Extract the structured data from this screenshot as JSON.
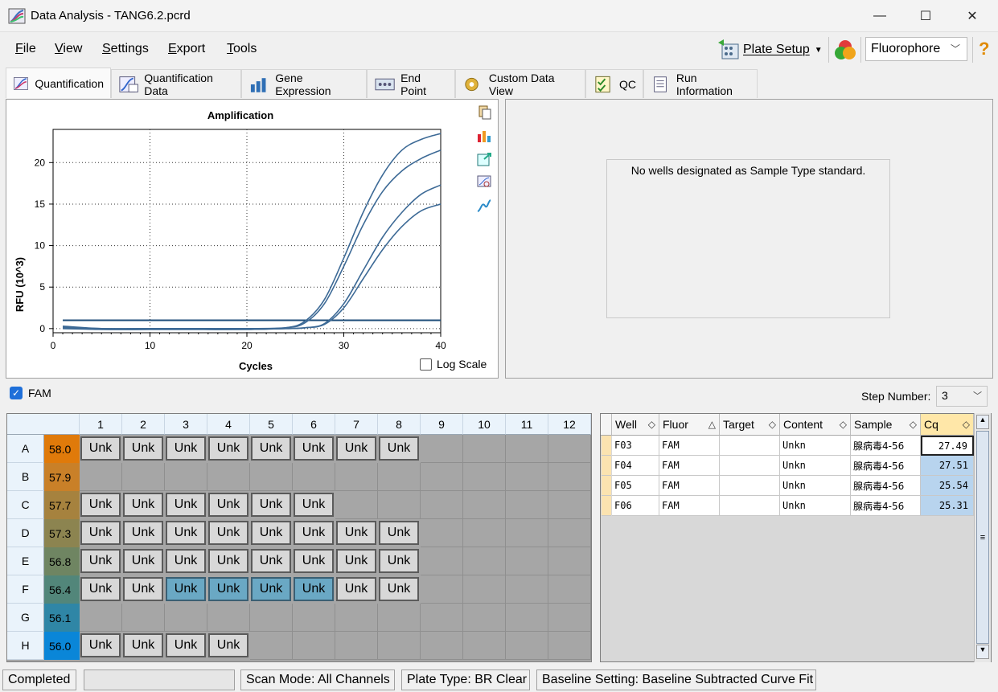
{
  "window": {
    "title": "Data Analysis - TANG6.2.pcrd",
    "minimize": "—",
    "maximize": "☐",
    "close": "✕"
  },
  "menu": {
    "items": [
      {
        "accel": "F",
        "rest": "ile"
      },
      {
        "accel": "V",
        "rest": "iew"
      },
      {
        "accel": "S",
        "rest": "ettings"
      },
      {
        "accel": "E",
        "rest": "xport"
      },
      {
        "accel": "T",
        "rest": "ools"
      }
    ],
    "plate_setup": "Plate Setup",
    "fluorophore_select": "Fluorophore",
    "help": "?"
  },
  "tabs": [
    {
      "label": "Quantification",
      "active": true
    },
    {
      "label": "Quantification Data"
    },
    {
      "label": "Gene Expression"
    },
    {
      "label": "End Point"
    },
    {
      "label": "Custom Data View"
    },
    {
      "label": "QC"
    },
    {
      "label": "Run Information"
    }
  ],
  "chart_data": {
    "type": "line",
    "title": "Amplification",
    "xlabel": "Cycles",
    "ylabel": "RFU (10^3)",
    "xlim": [
      0,
      40
    ],
    "ylim": [
      -0.5,
      24
    ],
    "xticks": [
      0,
      10,
      20,
      30,
      40
    ],
    "yticks": [
      0,
      5,
      10,
      15,
      20
    ],
    "grid": "dotted",
    "threshold": 1.0,
    "series": [
      {
        "x": [
          1,
          5,
          10,
          15,
          20,
          24,
          26,
          28,
          30,
          32,
          34,
          36,
          38,
          40
        ],
        "values": [
          0.3,
          0.0,
          0.0,
          0.0,
          0.0,
          0.1,
          0.9,
          3.5,
          8.5,
          14.0,
          18.5,
          21.5,
          22.8,
          23.5
        ]
      },
      {
        "x": [
          1,
          5,
          10,
          15,
          20,
          24,
          26,
          28,
          30,
          32,
          34,
          36,
          38,
          40
        ],
        "values": [
          0.2,
          0.0,
          0.0,
          0.0,
          0.0,
          0.1,
          0.7,
          3.0,
          7.5,
          12.5,
          16.5,
          19.0,
          20.5,
          21.5
        ]
      },
      {
        "x": [
          1,
          5,
          10,
          15,
          20,
          24,
          26,
          28,
          30,
          32,
          34,
          36,
          38,
          40
        ],
        "values": [
          0.1,
          -0.1,
          -0.1,
          -0.1,
          -0.1,
          0.0,
          0.1,
          0.6,
          3.0,
          7.0,
          11.0,
          14.0,
          16.2,
          17.3
        ]
      },
      {
        "x": [
          1,
          5,
          10,
          15,
          20,
          24,
          26,
          28,
          30,
          32,
          34,
          36,
          38,
          40
        ],
        "values": [
          0.0,
          -0.1,
          -0.1,
          -0.1,
          -0.1,
          0.0,
          0.1,
          0.5,
          2.5,
          6.0,
          9.5,
          12.3,
          14.2,
          15.0
        ]
      }
    ]
  },
  "log_scale_label": "Log Scale",
  "standards_message": "No wells designated as Sample Type standard.",
  "fam": {
    "label": "FAM",
    "checked": true
  },
  "step": {
    "label": "Step Number:",
    "value": "3"
  },
  "plate": {
    "columns": [
      "1",
      "2",
      "3",
      "4",
      "5",
      "6",
      "7",
      "8",
      "9",
      "10",
      "11",
      "12"
    ],
    "rows": [
      {
        "label": "A",
        "temp": "58.0",
        "temp_color": "#e07a0a",
        "wells": [
          "Unk",
          "Unk",
          "Unk",
          "Unk",
          "Unk",
          "Unk",
          "Unk",
          "Unk",
          "",
          "",
          "",
          ""
        ],
        "selected": []
      },
      {
        "label": "B",
        "temp": "57.9",
        "temp_color": "#c98028",
        "wells": [
          "",
          "",
          "",
          "",
          "",
          "",
          "",
          "",
          "",
          "",
          "",
          ""
        ],
        "selected": []
      },
      {
        "label": "C",
        "temp": "57.7",
        "temp_color": "#a6823e",
        "wells": [
          "Unk",
          "Unk",
          "Unk",
          "Unk",
          "Unk",
          "Unk",
          "",
          "",
          "",
          "",
          "",
          ""
        ],
        "selected": []
      },
      {
        "label": "D",
        "temp": "57.3",
        "temp_color": "#8c8450",
        "wells": [
          "Unk",
          "Unk",
          "Unk",
          "Unk",
          "Unk",
          "Unk",
          "Unk",
          "Unk",
          "",
          "",
          "",
          ""
        ],
        "selected": []
      },
      {
        "label": "E",
        "temp": "56.8",
        "temp_color": "#6f8562",
        "wells": [
          "Unk",
          "Unk",
          "Unk",
          "Unk",
          "Unk",
          "Unk",
          "Unk",
          "Unk",
          "",
          "",
          "",
          ""
        ],
        "selected": []
      },
      {
        "label": "F",
        "temp": "56.4",
        "temp_color": "#52867a",
        "wells": [
          "Unk",
          "Unk",
          "Unk",
          "Unk",
          "Unk",
          "Unk",
          "Unk",
          "Unk",
          "",
          "",
          "",
          ""
        ],
        "selected": [
          2,
          3,
          4,
          5
        ]
      },
      {
        "label": "G",
        "temp": "56.1",
        "temp_color": "#2f86a6",
        "wells": [
          "",
          "",
          "",
          "",
          "",
          "",
          "",
          "",
          "",
          "",
          "",
          ""
        ],
        "selected": []
      },
      {
        "label": "H",
        "temp": "56.0",
        "temp_color": "#0a86d8",
        "wells": [
          "Unk",
          "Unk",
          "Unk",
          "Unk",
          "",
          "",
          "",
          "",
          "",
          "",
          "",
          ""
        ],
        "selected": []
      }
    ]
  },
  "table": {
    "headers": [
      {
        "label": "Well",
        "sort": "◇"
      },
      {
        "label": "Fluor",
        "sort": "△"
      },
      {
        "label": "Target",
        "sort": "◇"
      },
      {
        "label": "Content",
        "sort": "◇"
      },
      {
        "label": "Sample",
        "sort": "◇"
      },
      {
        "label": "Cq",
        "sort": "◇"
      }
    ],
    "rows": [
      [
        "F03",
        "FAM",
        "",
        "Unkn",
        "腺病毒4-56",
        "27.49"
      ],
      [
        "F04",
        "FAM",
        "",
        "Unkn",
        "腺病毒4-56",
        "27.51"
      ],
      [
        "F05",
        "FAM",
        "",
        "Unkn",
        "腺病毒4-56",
        "25.54"
      ],
      [
        "F06",
        "FAM",
        "",
        "Unkn",
        "腺病毒4-56",
        "25.31"
      ]
    ]
  },
  "status": {
    "state": "Completed",
    "scan_mode": "Scan Mode: All Channels",
    "plate_type": "Plate Type: BR Clear",
    "baseline": "Baseline Setting: Baseline Subtracted Curve Fit"
  },
  "colors": {
    "accent": "#1f4e79",
    "selected_well": "#6aa8c4",
    "cq_cell": "#b8d4ee"
  }
}
